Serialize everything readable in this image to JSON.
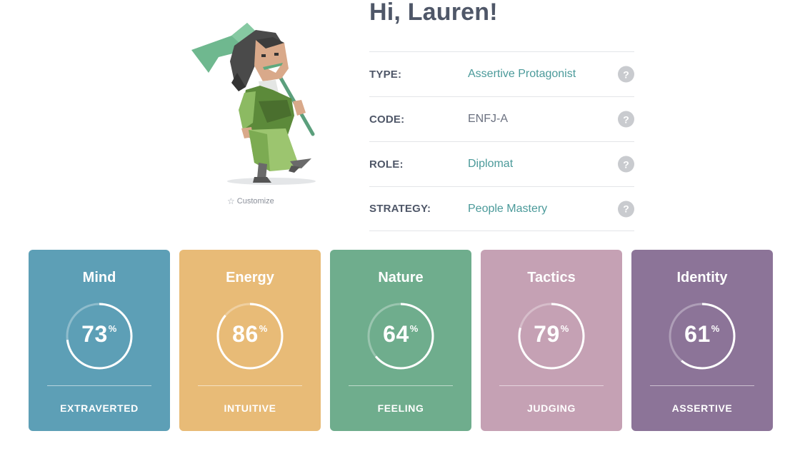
{
  "greeting": "Hi, Lauren!",
  "customize_label": "Customize",
  "info": [
    {
      "label": "TYPE:",
      "value": "Assertive Protagonist",
      "help": "?"
    },
    {
      "label": "CODE:",
      "value": "ENFJ-A",
      "help": "?"
    },
    {
      "label": "ROLE:",
      "value": "Diplomat",
      "help": "?"
    },
    {
      "label": "STRATEGY:",
      "value": "People Mastery",
      "help": "?"
    }
  ],
  "cards": [
    {
      "title": "Mind",
      "percent": "73",
      "unit": "%",
      "trait": "EXTRAVERTED",
      "color": "#5d9fb6"
    },
    {
      "title": "Energy",
      "percent": "86",
      "unit": "%",
      "trait": "INTUITIVE",
      "color": "#e8bb77"
    },
    {
      "title": "Nature",
      "percent": "64",
      "unit": "%",
      "trait": "FEELING",
      "color": "#6fad8d"
    },
    {
      "title": "Tactics",
      "percent": "79",
      "unit": "%",
      "trait": "JUDGING",
      "color": "#c5a1b4"
    },
    {
      "title": "Identity",
      "percent": "61",
      "unit": "%",
      "trait": "ASSERTIVE",
      "color": "#8c7498"
    }
  ]
}
